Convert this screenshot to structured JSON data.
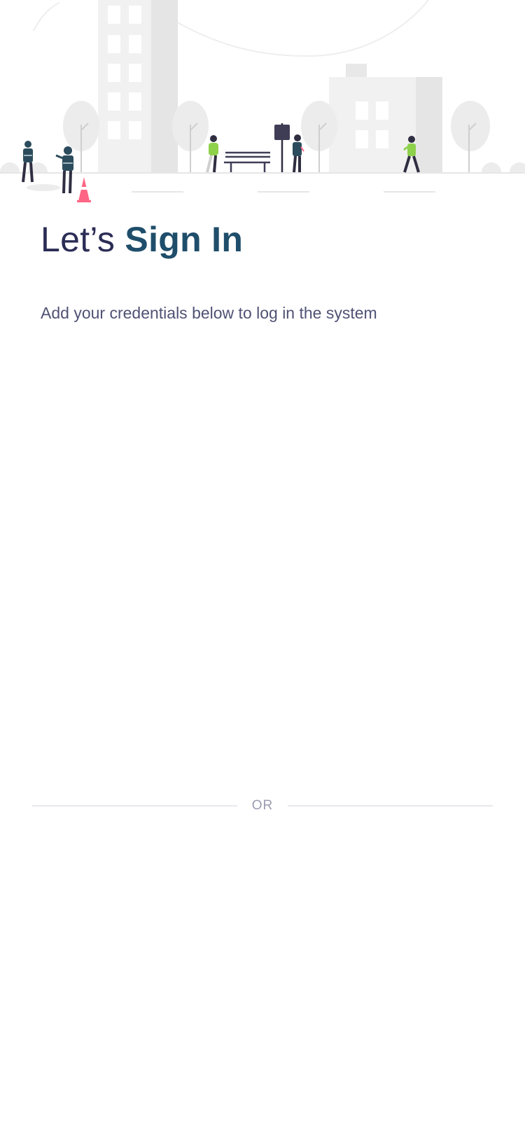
{
  "hero": {
    "illustration": "city-street-scene",
    "colors": {
      "building": "#f1f1f1",
      "building_shade": "#e5e5e5",
      "tree": "#ececec",
      "ground_line": "#e6e6e6",
      "figure_dark": "#2f2e41",
      "figure_teal": "#2b4c5c",
      "figure_green": "#8ed14b",
      "cone": "#ff6584"
    }
  },
  "title": {
    "light": "Let’s",
    "bold": "Sign In"
  },
  "subtitle": "Add your credentials below to log in the system",
  "divider": {
    "label": "OR"
  }
}
